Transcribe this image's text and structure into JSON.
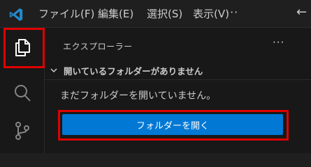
{
  "menu": {
    "items": [
      {
        "label": "ファイル(F)"
      },
      {
        "label": "編集(E)"
      },
      {
        "label": "選択(S)"
      },
      {
        "label": "表示(V)"
      }
    ],
    "more_label": "···",
    "back_icon": "←"
  },
  "activity_bar": {
    "items": [
      {
        "name": "explorer",
        "icon": "files-icon",
        "active": true
      },
      {
        "name": "search",
        "icon": "search-icon",
        "active": false
      },
      {
        "name": "source-control",
        "icon": "source-control-icon",
        "active": false
      }
    ]
  },
  "explorer": {
    "title": "エクスプローラー",
    "more_label": "···",
    "section": {
      "label": "開いているフォルダーがありません",
      "expanded": true
    },
    "welcome": {
      "message": "まだフォルダーを開いていません。",
      "button_label": "フォルダーを開く"
    }
  },
  "colors": {
    "accent": "#0078d4",
    "highlight": "#e00000",
    "logo": "#2489ca"
  }
}
